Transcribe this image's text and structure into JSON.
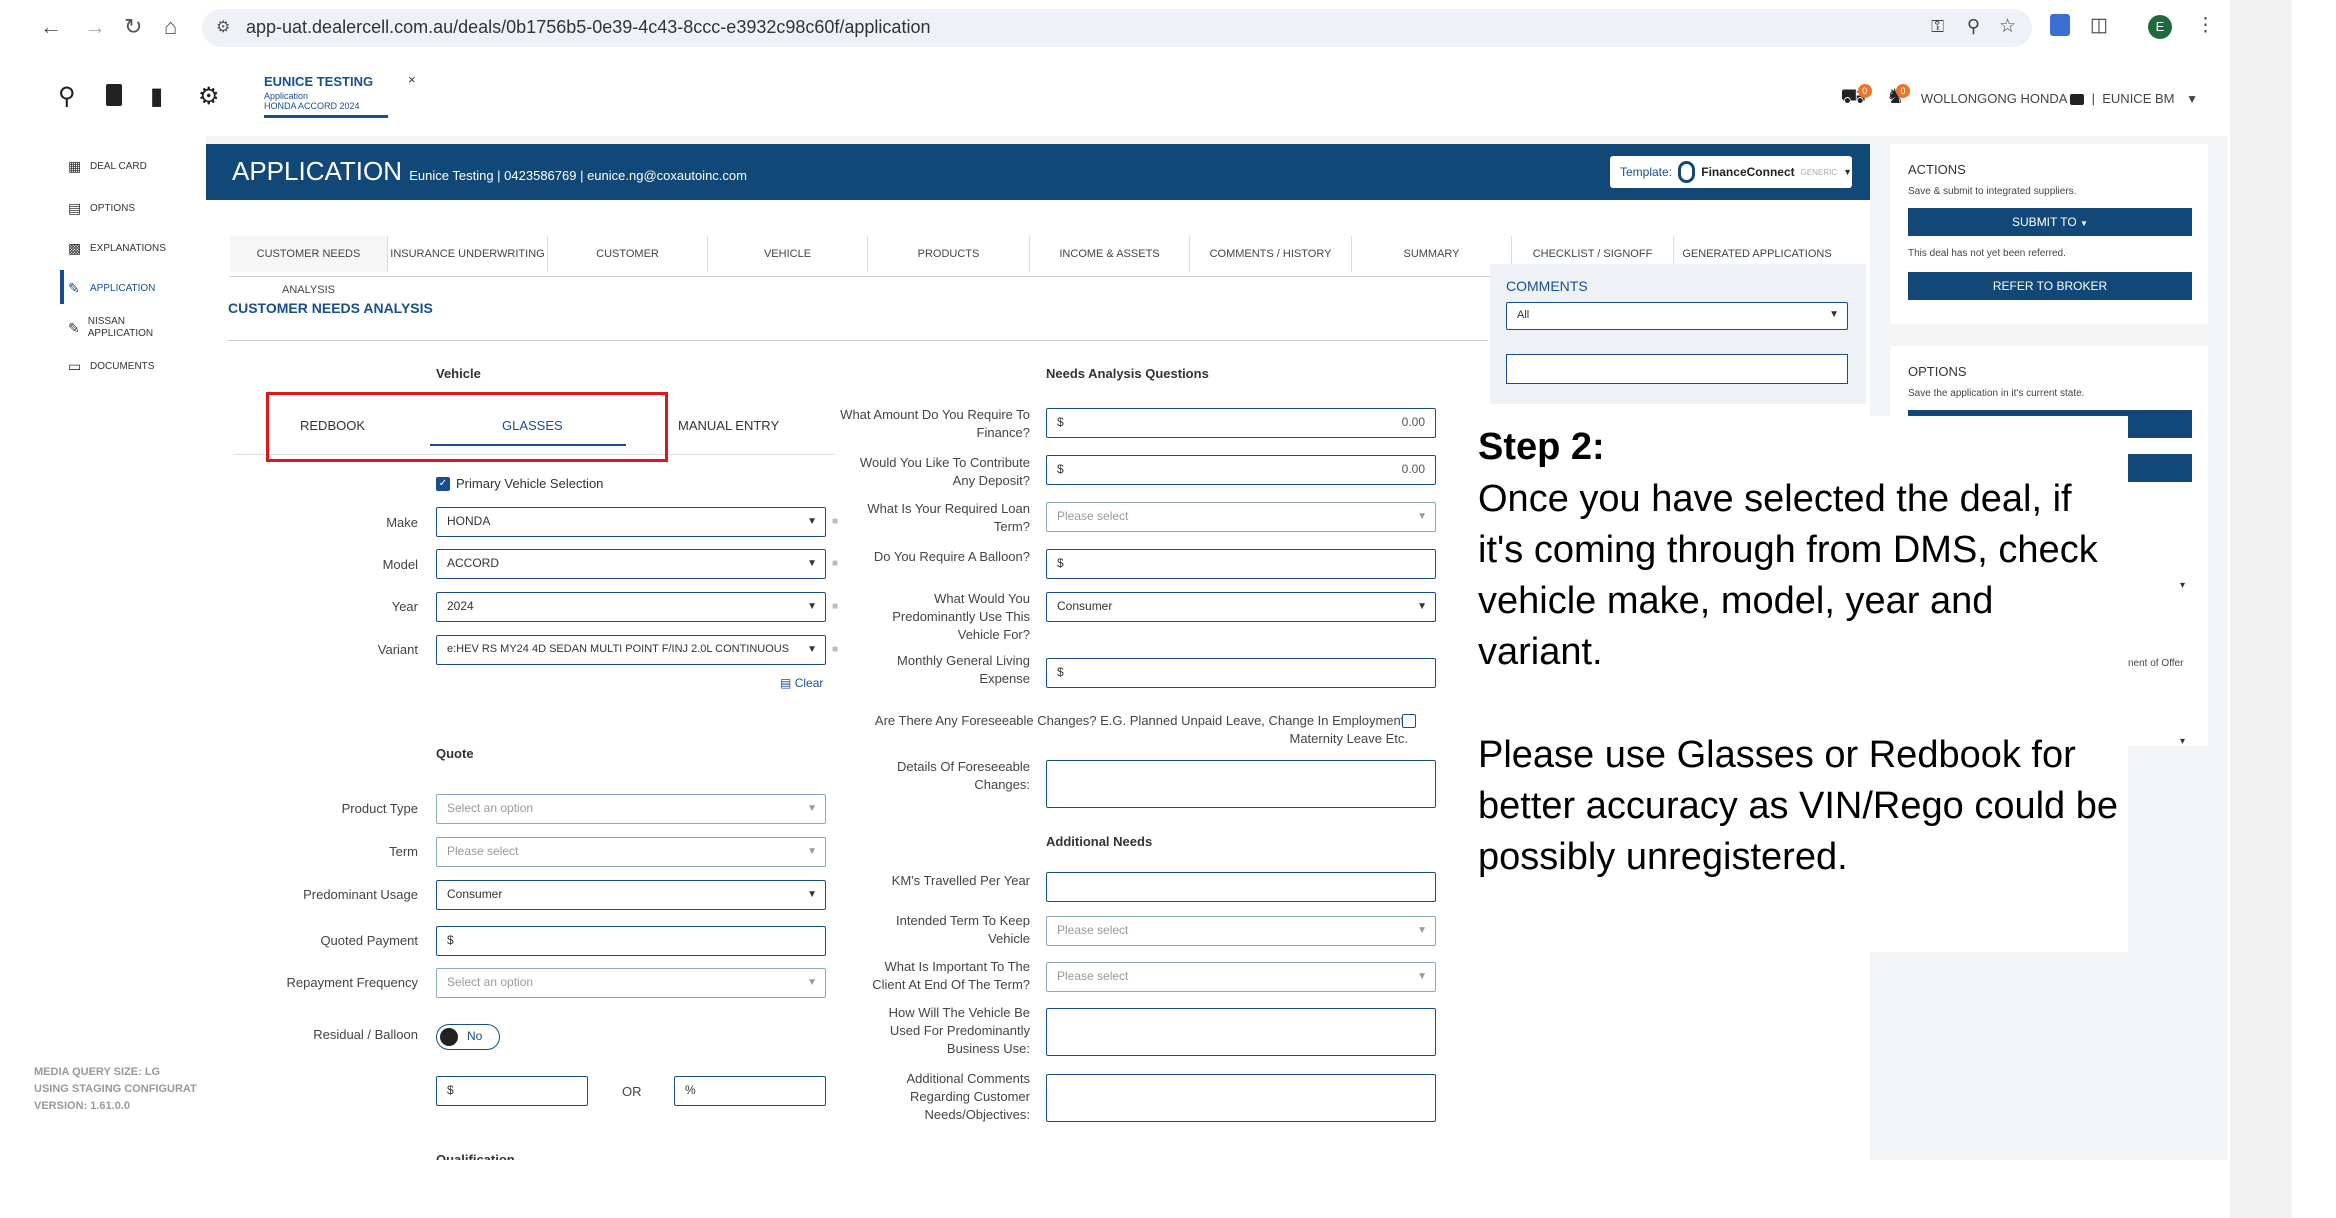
{
  "browser": {
    "url": "app-uat.dealercell.com.au/deals/0b1756b5-0e39-4c43-8ccc-e3932c98c60f/application",
    "profile_initial": "E"
  },
  "header": {
    "deal_title": "EUNICE TESTING",
    "deal_subtitle": "Application",
    "deal_vehicle": "HONDA ACCORD 2024",
    "close_symbol": "×",
    "dealer": "WOLLONGONG HONDA",
    "user": "EUNICE BM",
    "separator": "|",
    "cart_badge": "0",
    "bell_badge": "0"
  },
  "sidebar": {
    "items": [
      {
        "label": "DEAL CARD"
      },
      {
        "label": "OPTIONS"
      },
      {
        "label": "EXPLANATIONS"
      },
      {
        "label": "APPLICATION"
      },
      {
        "label": "NISSAN APPLICATION"
      },
      {
        "label": "DOCUMENTS"
      }
    ],
    "footer": [
      "MEDIA QUERY SIZE: LG",
      "USING STAGING CONFIGURAT",
      "VERSION: 1.61.0.0"
    ]
  },
  "main": {
    "title": "APPLICATION",
    "subtitle": "Eunice Testing | 0423586769 | eunice.ng@coxautoinc.com",
    "template_label": "Template:",
    "template_name": "FinanceConnect",
    "template_type": "GENERIC",
    "steps": [
      "CUSTOMER NEEDS ANALYSIS",
      "INSURANCE UNDERWRITING",
      "CUSTOMER",
      "VEHICLE",
      "PRODUCTS",
      "INCOME & ASSETS",
      "COMMENTS / HISTORY",
      "SUMMARY",
      "CHECKLIST / SIGNOFF",
      "GENERATED APPLICATIONS"
    ],
    "section_title": "CUSTOMER NEEDS ANALYSIS"
  },
  "vehicle": {
    "heading": "Vehicle",
    "tabs": [
      "REDBOOK",
      "GLASSES",
      "MANUAL ENTRY"
    ],
    "primary_label": "Primary Vehicle Selection",
    "make_label": "Make",
    "make": "HONDA",
    "model_label": "Model",
    "model": "ACCORD",
    "year_label": "Year",
    "year": "2024",
    "variant_label": "Variant",
    "variant": "e:HEV RS MY24 4D SEDAN MULTI POINT F/INJ 2.0L CONTINUOUS",
    "clear": "Clear"
  },
  "quote": {
    "heading": "Quote",
    "product_type_label": "Product Type",
    "product_type_placeholder": "Select an option",
    "term_label": "Term",
    "term_placeholder": "Please select",
    "usage_label": "Predominant Usage",
    "usage": "Consumer",
    "payment_label": "Quoted Payment",
    "payment": "$",
    "frequency_label": "Repayment Frequency",
    "frequency_placeholder": "Select an option",
    "residual_label": "Residual / Balloon",
    "residual_toggle": "No",
    "residual_dollar": "$",
    "or": "OR",
    "residual_pct": "%",
    "next_heading": "Qualification"
  },
  "needs": {
    "heading": "Needs Analysis Questions",
    "finance_label": "What Amount Do You Require To Finance?",
    "finance_prefix": "$",
    "finance": "0.00",
    "deposit_label": "Would You Like To Contribute Any Deposit?",
    "deposit_prefix": "$",
    "deposit": "0.00",
    "loan_term_label": "What Is Your Required Loan Term?",
    "loan_term_placeholder": "Please select",
    "balloon_label": "Do You Require A Balloon?",
    "balloon_prefix": "$",
    "use_label": "What Would You Predominantly Use This Vehicle For?",
    "use": "Consumer",
    "living_label": "Monthly General Living Expense",
    "living_prefix": "$",
    "changes_label": "Are There Any Foreseeable Changes? E.G. Planned Unpaid Leave, Change In Employment, Maternity Leave Etc.",
    "details_label": "Details Of Foreseeable Changes:"
  },
  "additional": {
    "heading": "Additional Needs",
    "km_label": "KM's Travelled Per Year",
    "keep_label": "Intended Term To Keep Vehicle",
    "keep_placeholder": "Please select",
    "important_label": "What Is Important To The Client At End Of The Term?",
    "important_placeholder": "Please select",
    "business_label": "How Will The Vehicle Be Used For Predominantly Business Use:",
    "comments_label": "Additional Comments Regarding Customer Needs/Objectives:"
  },
  "comments_panel": {
    "title": "COMMENTS",
    "filter": "All"
  },
  "actions": {
    "title": "ACTIONS",
    "desc": "Save & submit to integrated suppliers.",
    "submit": "SUBMIT TO",
    "note": "This deal has not yet been referred.",
    "refer": "REFER TO BROKER"
  },
  "options_panel": {
    "title": "OPTIONS",
    "desc": "Save the application in it's current state.",
    "partial": "nent of Offer"
  },
  "overlay": {
    "title": "Step 2:",
    "p1": "Once you have selected the deal, if it's coming through from DMS, check vehicle make, model, year and variant.",
    "p2": "Please use Glasses or Redbook for better accuracy as VIN/Rego could be possibly unregistered."
  },
  "colors": {
    "brand": "#114878",
    "highlight": "#e0161b"
  }
}
